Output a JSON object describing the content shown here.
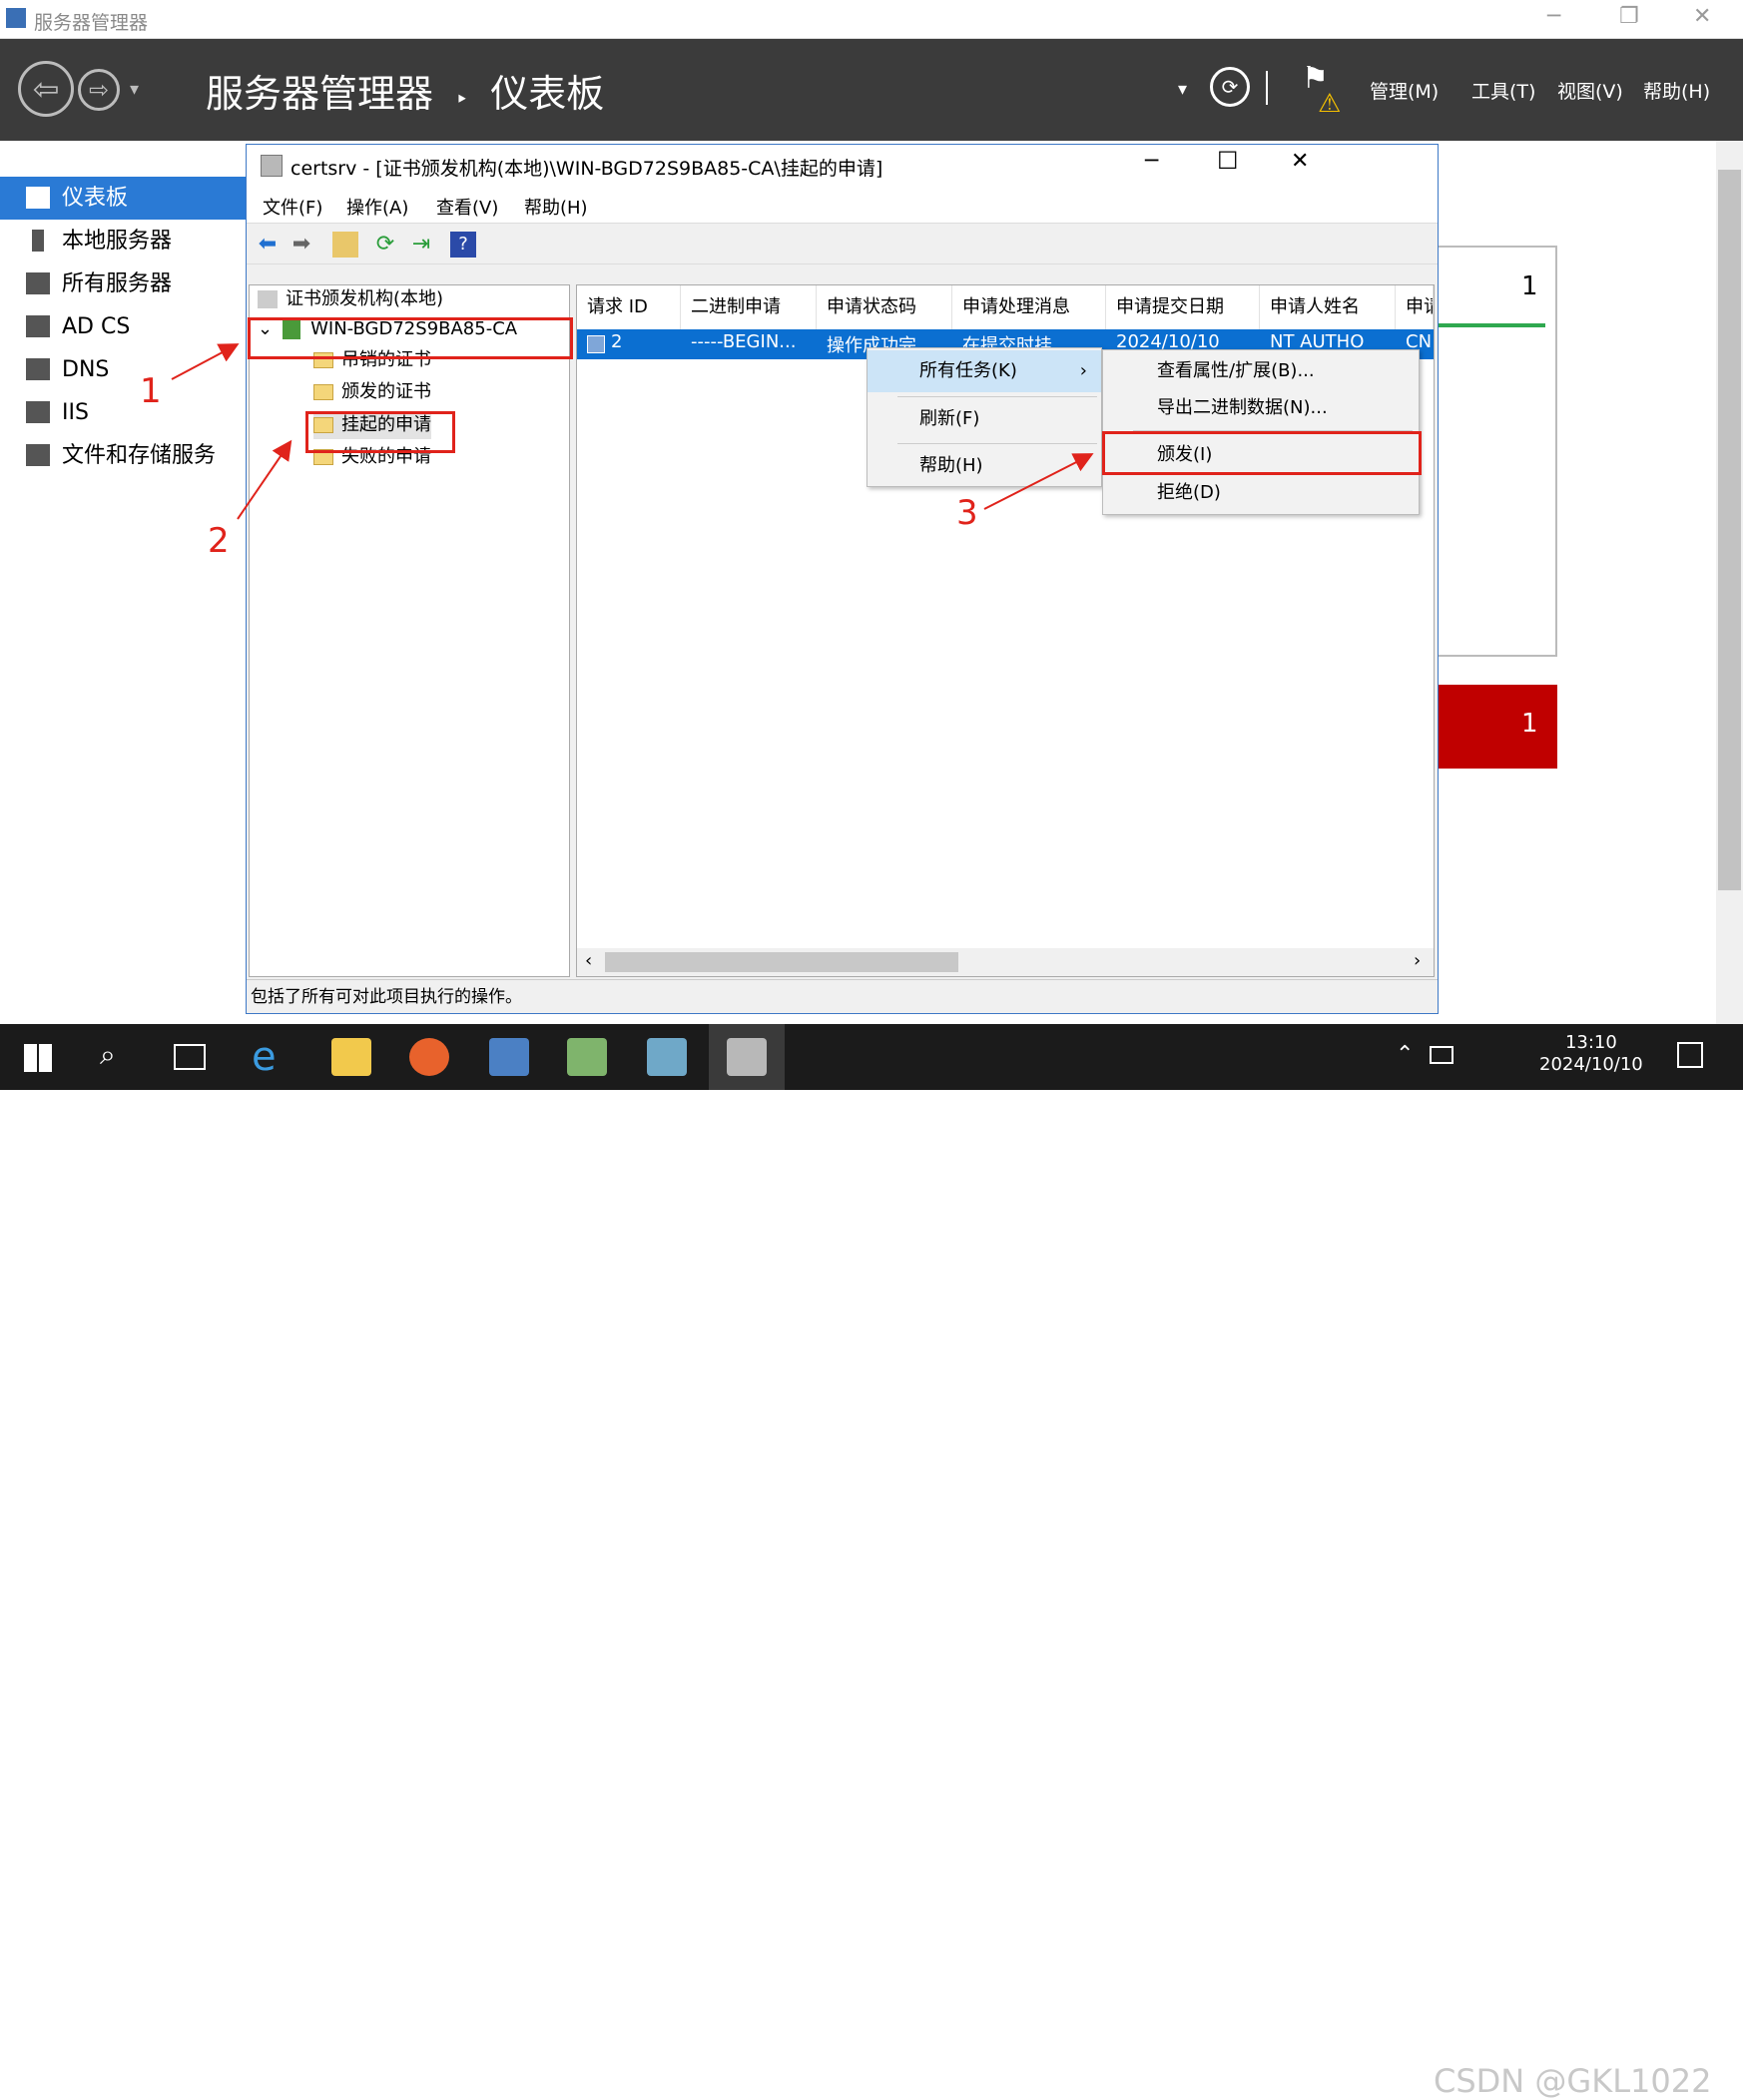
{
  "window": {
    "title": "服务器管理器"
  },
  "header": {
    "breadcrumb_app": "服务器管理器",
    "breadcrumb_sep": "‣",
    "breadcrumb_page": "仪表板",
    "menus": [
      "管理(M)",
      "工具(T)",
      "视图(V)",
      "帮助(H)"
    ]
  },
  "nav": {
    "items": [
      {
        "label": "仪表板",
        "selected": true
      },
      {
        "label": "本地服务器"
      },
      {
        "label": "所有服务器"
      },
      {
        "label": "AD CS"
      },
      {
        "label": "DNS"
      },
      {
        "label": "IIS"
      },
      {
        "label": "文件和存储服务"
      }
    ]
  },
  "dashboard": {
    "tile1_count": "1",
    "tile2_count": "1"
  },
  "mmc": {
    "title": "certsrv - [证书颁发机构(本地)\\WIN-BGD72S9BA85-CA\\挂起的申请]",
    "menus": [
      "文件(F)",
      "操作(A)",
      "查看(V)",
      "帮助(H)"
    ],
    "tree": {
      "root": "证书颁发机构(本地)",
      "ca": "WIN-BGD72S9BA85-CA",
      "folders": [
        "吊销的证书",
        "颁发的证书",
        "挂起的申请",
        "失败的申请"
      ]
    },
    "columns": [
      "请求 ID",
      "二进制申请",
      "申请状态码",
      "申请处理消息",
      "申请提交日期",
      "申请人姓名",
      "申请"
    ],
    "row": {
      "id": "2",
      "binary": "-----BEGIN...",
      "status": "操作成功完",
      "message": "在提交时挂",
      "date": "2024/10/10",
      "requester": "NT AUTHO",
      "extra": "CN"
    },
    "status_text": "包括了所有可对此项目执行的操作。"
  },
  "context_menu": {
    "items": [
      "所有任务(K)",
      "刷新(F)",
      "帮助(H)"
    ],
    "submenu": [
      "查看属性/扩展(B)...",
      "导出二进制数据(N)...",
      "颁发(I)",
      "拒绝(D)"
    ]
  },
  "annotations": [
    "1",
    "2",
    "3"
  ],
  "taskbar": {
    "time": "13:10",
    "date": "2024/10/10",
    "watermark": "CSDN @GKL1022"
  },
  "colors": {
    "accent": "#2a7ad5",
    "header": "#3b3b3b",
    "annotation": "#e0231b",
    "alert": "#c00000"
  }
}
